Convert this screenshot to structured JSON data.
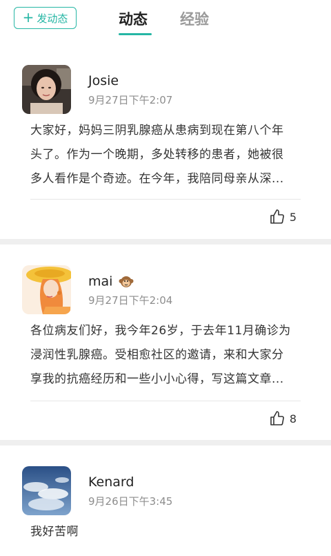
{
  "header": {
    "post_button": "发动态",
    "tabs": [
      {
        "label": "动态",
        "active": true
      },
      {
        "label": "经验",
        "active": false
      }
    ]
  },
  "posts": [
    {
      "author": "Josie",
      "time": "9月27日下午2:07",
      "lines": [
        "大家好，妈妈三阴乳腺癌从患病到现在第八个年",
        "头了。作为一个晚期，多处转移的患者，她被很",
        "多人看作是个奇迹。在今年，我陪同母亲从深..."
      ],
      "likes": "5"
    },
    {
      "author": "mai",
      "author_emoji": "monkey-emoji",
      "time": "9月27日下午2:04",
      "lines": [
        "各位病友们好，我今年26岁，于去年11月确诊为",
        "浸润性乳腺癌。受相愈社区的邀请，来和大家分",
        "享我的抗癌经历和一些小小心得，写这篇文章..."
      ],
      "likes": "8"
    },
    {
      "author": "Kenard",
      "time": "9月26日下午3:45",
      "lines": [
        "我好苦啊"
      ]
    }
  ],
  "colors": {
    "accent": "#25b6a4",
    "muted": "#8d8d8d",
    "separator": "#efefef"
  }
}
